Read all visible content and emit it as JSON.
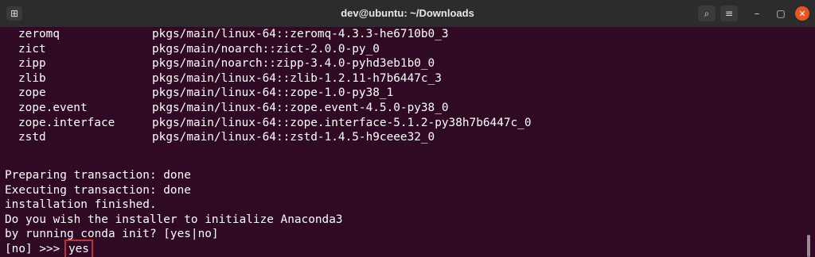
{
  "window": {
    "title": "dev@ubuntu: ~/Downloads",
    "icons": {
      "new_tab": "new-tab-icon",
      "search": "search-icon",
      "menu": "hamburger-menu-icon",
      "minimize": "minimize-icon",
      "maximize": "maximize-icon",
      "close": "close-icon"
    }
  },
  "packages": [
    {
      "name": "zeromq",
      "source": "pkgs/main/linux-64::zeromq-4.3.3-he6710b0_3"
    },
    {
      "name": "zict",
      "source": "pkgs/main/noarch::zict-2.0.0-py_0"
    },
    {
      "name": "zipp",
      "source": "pkgs/main/noarch::zipp-3.4.0-pyhd3eb1b0_0"
    },
    {
      "name": "zlib",
      "source": "pkgs/main/linux-64::zlib-1.2.11-h7b6447c_3"
    },
    {
      "name": "zope",
      "source": "pkgs/main/linux-64::zope-1.0-py38_1"
    },
    {
      "name": "zope.event",
      "source": "pkgs/main/linux-64::zope.event-4.5.0-py38_0"
    },
    {
      "name": "zope.interface",
      "source": "pkgs/main/linux-64::zope.interface-5.1.2-py38h7b6447c_0"
    },
    {
      "name": "zstd",
      "source": "pkgs/main/linux-64::zstd-1.4.5-h9ceee32_0"
    }
  ],
  "messages": [
    "Preparing transaction: done",
    "Executing transaction: done",
    "installation finished.",
    "Do you wish the installer to initialize Anaconda3",
    "by running conda init? [yes|no]"
  ],
  "prompt": {
    "text": "[no] >>> ",
    "answer": "yes"
  },
  "colors": {
    "background": "#300a24",
    "titlebar": "#2c2c2c",
    "text": "#ffffff",
    "highlight": "#c0303a",
    "close": "#e95420"
  }
}
